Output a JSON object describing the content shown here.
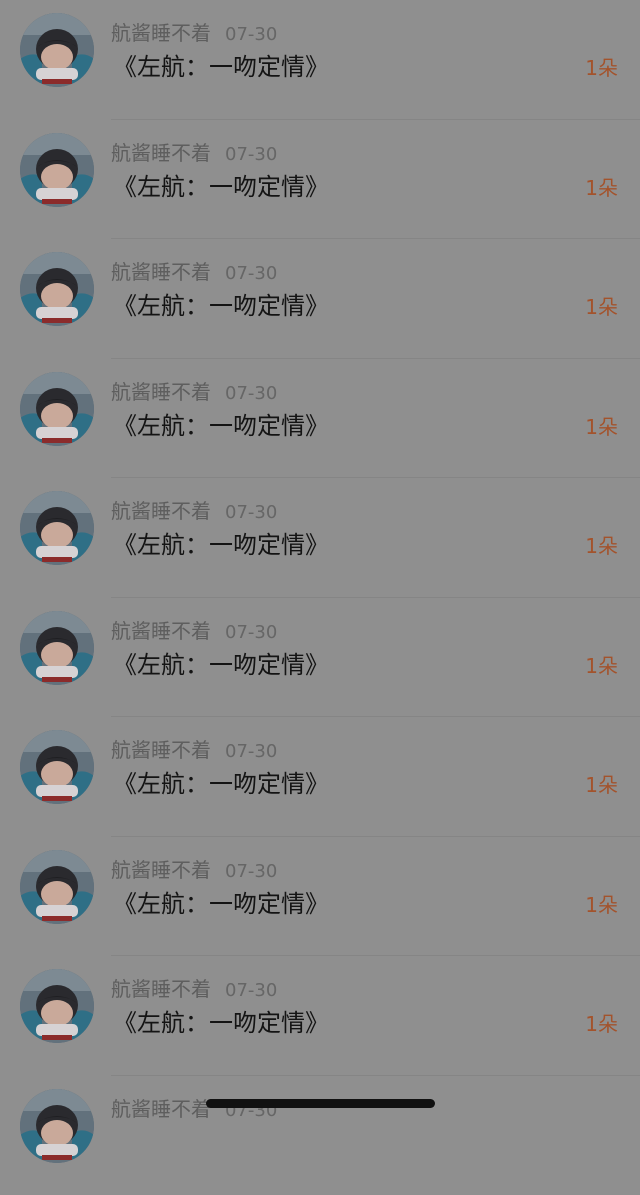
{
  "items": [
    {
      "username": "航酱睡不着",
      "date": "07-30",
      "title": "《左航：一吻定情》",
      "count": "1朵"
    },
    {
      "username": "航酱睡不着",
      "date": "07-30",
      "title": "《左航：一吻定情》",
      "count": "1朵"
    },
    {
      "username": "航酱睡不着",
      "date": "07-30",
      "title": "《左航：一吻定情》",
      "count": "1朵"
    },
    {
      "username": "航酱睡不着",
      "date": "07-30",
      "title": "《左航：一吻定情》",
      "count": "1朵"
    },
    {
      "username": "航酱睡不着",
      "date": "07-30",
      "title": "《左航：一吻定情》",
      "count": "1朵"
    },
    {
      "username": "航酱睡不着",
      "date": "07-30",
      "title": "《左航：一吻定情》",
      "count": "1朵"
    },
    {
      "username": "航酱睡不着",
      "date": "07-30",
      "title": "《左航：一吻定情》",
      "count": "1朵"
    },
    {
      "username": "航酱睡不着",
      "date": "07-30",
      "title": "《左航：一吻定情》",
      "count": "1朵"
    },
    {
      "username": "航酱睡不着",
      "date": "07-30",
      "title": "《左航：一吻定情》",
      "count": "1朵"
    },
    {
      "username": "航酱睡不着",
      "date": "07-30",
      "title": "",
      "count": ""
    }
  ],
  "colors": {
    "overlay_background": "#8f8f8f",
    "count_accent": "#a3532c",
    "title_text": "#141414",
    "meta_text": "#5e5e5e"
  },
  "icons": {
    "avatar": "user-avatar-photo",
    "home_indicator": "home-indicator-bar"
  }
}
